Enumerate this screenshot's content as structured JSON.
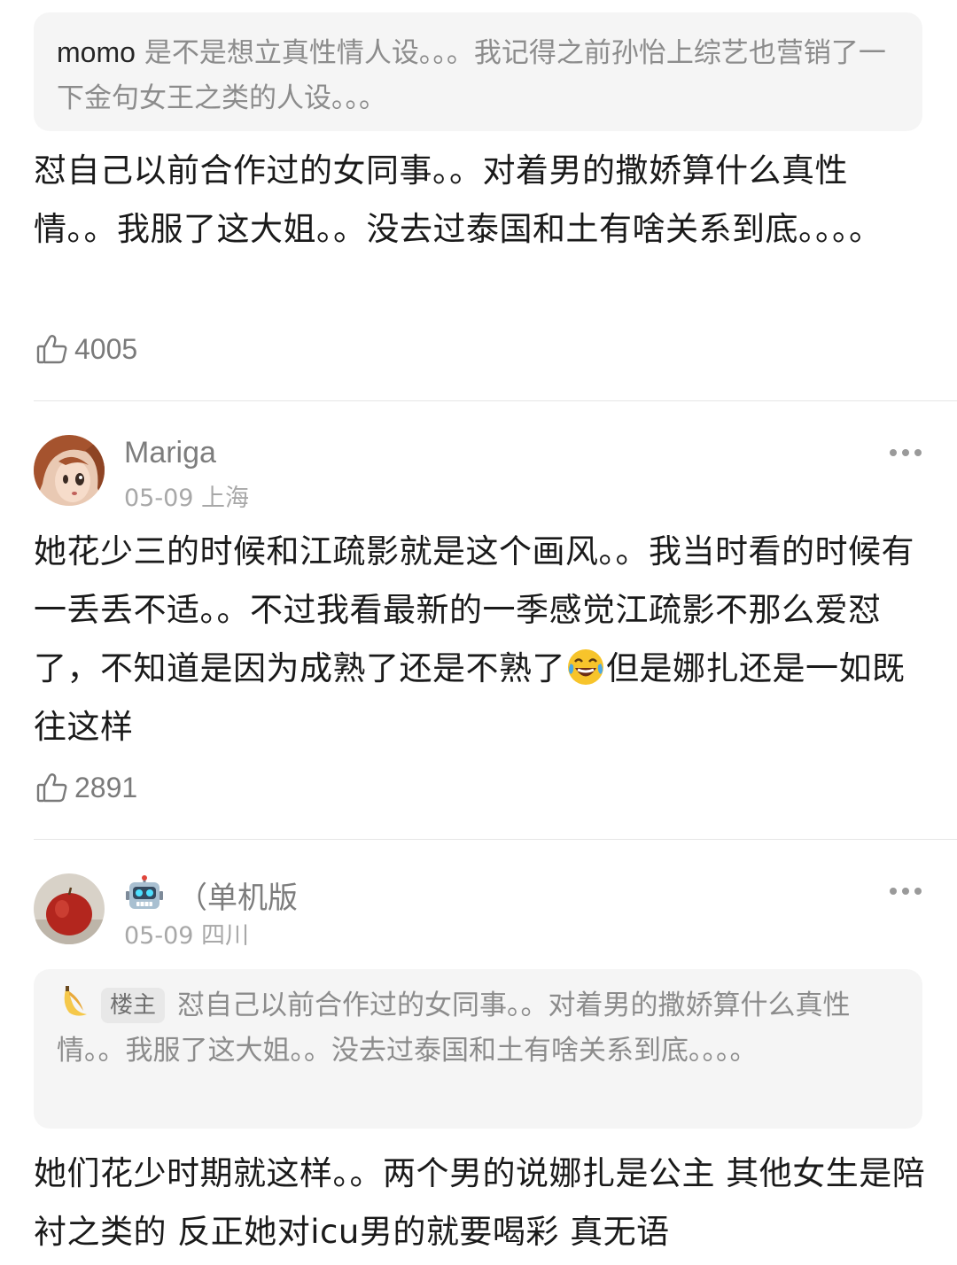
{
  "comment0": {
    "quote": {
      "user": "momo",
      "text": "是不是想立真性情人设。。。我记得之前孙怡上综艺也营销了一下金句女王之类的人设。。。"
    },
    "text": "怼自己以前合作过的女同事。。对着男的撒娇算什么真性情。。我服了这大姐。。没去过泰国和土有啥关系到底。。。。",
    "likes": "4005"
  },
  "comment1": {
    "username": "Mariga",
    "meta": "05-09 上海",
    "text_part1": "她花少三的时候和江疏影就是这个画风。。我当时看的时候有一丢丢不适。。不过我看最新的一季感觉江疏影不那么爱怼了，不知道是因为成熟了还是不熟了",
    "emoji": "laughing-tears",
    "text_part2": "但是娜扎还是一如既往这样",
    "likes": "2891"
  },
  "comment2": {
    "username": "（单机版",
    "username_emoji": "robot",
    "meta": "05-09 四川",
    "quote": {
      "emoji": "banana",
      "badge": "楼主",
      "text": "怼自己以前合作过的女同事。。对着男的撒娇算什么真性情。。我服了这大姐。。没去过泰国和土有啥关系到底。。。。"
    },
    "text": "她们花少时期就这样。。两个男的说娜扎是公主 其他女生是陪衬之类的 反正她对icu男的就要喝彩 真无语"
  }
}
